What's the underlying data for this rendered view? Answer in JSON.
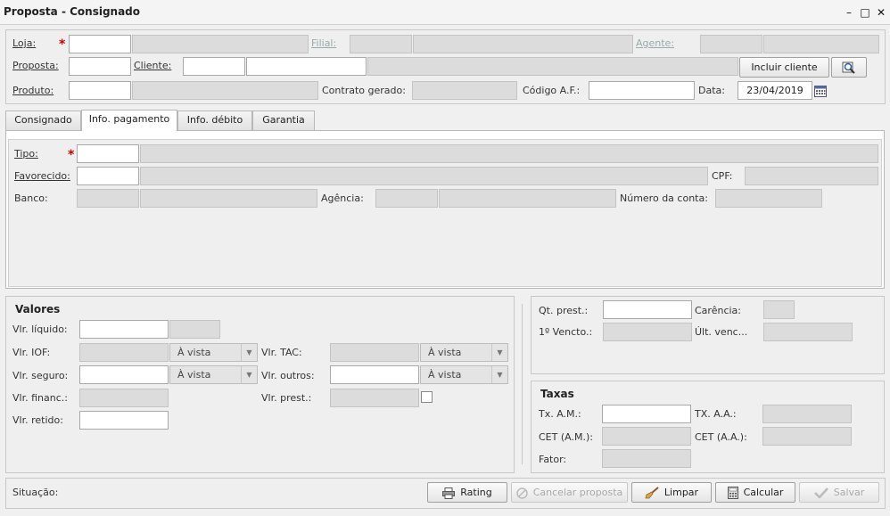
{
  "window": {
    "title": "Proposta - Consignado"
  },
  "header": {
    "loja_label": "Loja:",
    "filial_label": "Filial:",
    "agente_label": "Agente:",
    "proposta_label": "Proposta:",
    "cliente_label": "Cliente:",
    "incluir_cliente": "Incluir cliente",
    "produto_label": "Produto:",
    "contrato_label": "Contrato gerado:",
    "codigo_af_label": "Código A.F.:",
    "data_label": "Data:",
    "data_value": "23/04/2019"
  },
  "tabs": [
    {
      "label": "Consignado"
    },
    {
      "label": "Info. pagamento"
    },
    {
      "label": "Info. débito"
    },
    {
      "label": "Garantia"
    }
  ],
  "pagamento": {
    "tipo_label": "Tipo:",
    "favorecido_label": "Favorecido:",
    "cpf_label": "CPF:",
    "banco_label": "Banco:",
    "agencia_label": "Agência:",
    "conta_label": "Número da conta:"
  },
  "valores": {
    "title": "Valores",
    "liquido": "Vlr. líquido:",
    "iof": "Vlr. IOF:",
    "tac": "Vlr. TAC:",
    "seguro": "Vlr. seguro:",
    "outros": "Vlr. outros:",
    "financ": "Vlr. financ.:",
    "prest": "Vlr. prest.:",
    "retido": "Vlr. retido:",
    "a_vista": "À vista"
  },
  "prestacoes": {
    "qt_prest": "Qt. prest.:",
    "carencia": "Carência:",
    "primeiro_vencto": "1º Vencto.:",
    "ult_venc": "Últ. venc..."
  },
  "taxas": {
    "title": "Taxas",
    "tx_am": "Tx. A.M.:",
    "tx_aa": "TX. A.A.:",
    "cet_am": "CET (A.M.):",
    "cet_aa": "CET (A.A.):",
    "fator": "Fator:"
  },
  "footer": {
    "situacao": "Situação:",
    "rating": "Rating",
    "cancelar": "Cancelar proposta",
    "limpar": "Limpar",
    "calcular": "Calcular",
    "salvar": "Salvar"
  }
}
